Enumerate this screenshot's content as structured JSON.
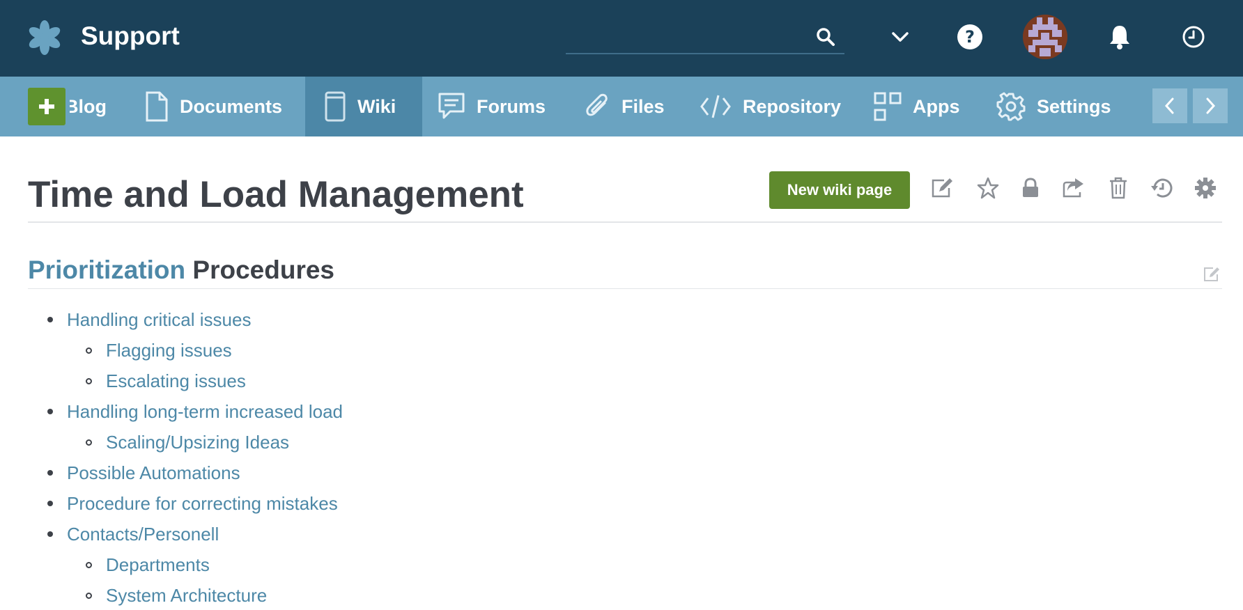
{
  "header": {
    "app_title": "Support",
    "search_placeholder": "",
    "icons": [
      "asterisk-logo-icon",
      "search-icon",
      "chevron-down-icon",
      "help-icon",
      "avatar",
      "bell-icon",
      "clock-icon"
    ]
  },
  "nav": {
    "items": [
      {
        "label": "Blog",
        "icon": "blog-icon"
      },
      {
        "label": "Documents",
        "icon": "document-icon"
      },
      {
        "label": "Wiki",
        "icon": "book-icon",
        "active": true
      },
      {
        "label": "Forums",
        "icon": "chat-icon"
      },
      {
        "label": "Files",
        "icon": "paperclip-icon"
      },
      {
        "label": "Repository",
        "icon": "code-icon"
      },
      {
        "label": "Apps",
        "icon": "grid-icon"
      },
      {
        "label": "Settings",
        "icon": "gear-icon"
      }
    ],
    "blog_visible": "Blog"
  },
  "page": {
    "title": "Time and Load Management",
    "new_page_label": "New wiki page",
    "actions": [
      "edit-icon",
      "star-icon",
      "lock-icon",
      "share-icon",
      "trash-icon",
      "history-icon",
      "settings-icon"
    ]
  },
  "section": {
    "heading_highlight": "Prioritization",
    "heading_rest": "Procedures"
  },
  "toc": [
    {
      "label": "Handling critical issues",
      "level": 1
    },
    {
      "label": "Flagging issues",
      "level": 2
    },
    {
      "label": "Escalating issues",
      "level": 2
    },
    {
      "label": "Handling long-term increased load",
      "level": 1
    },
    {
      "label": "Scaling/Upsizing Ideas",
      "level": 2
    },
    {
      "label": "Possible Automations",
      "level": 1
    },
    {
      "label": "Procedure for correcting mistakes",
      "level": 1
    },
    {
      "label": "Contacts/Personell",
      "level": 1
    },
    {
      "label": "Departments",
      "level": 2
    },
    {
      "label": "System Architecture",
      "level": 2
    }
  ],
  "colors": {
    "topbar": "#1b4159",
    "navbar": "#6aa3c1",
    "nav_active": "#4c87a7",
    "accent_green": "#5f8a2d",
    "link": "#4d88a7"
  }
}
